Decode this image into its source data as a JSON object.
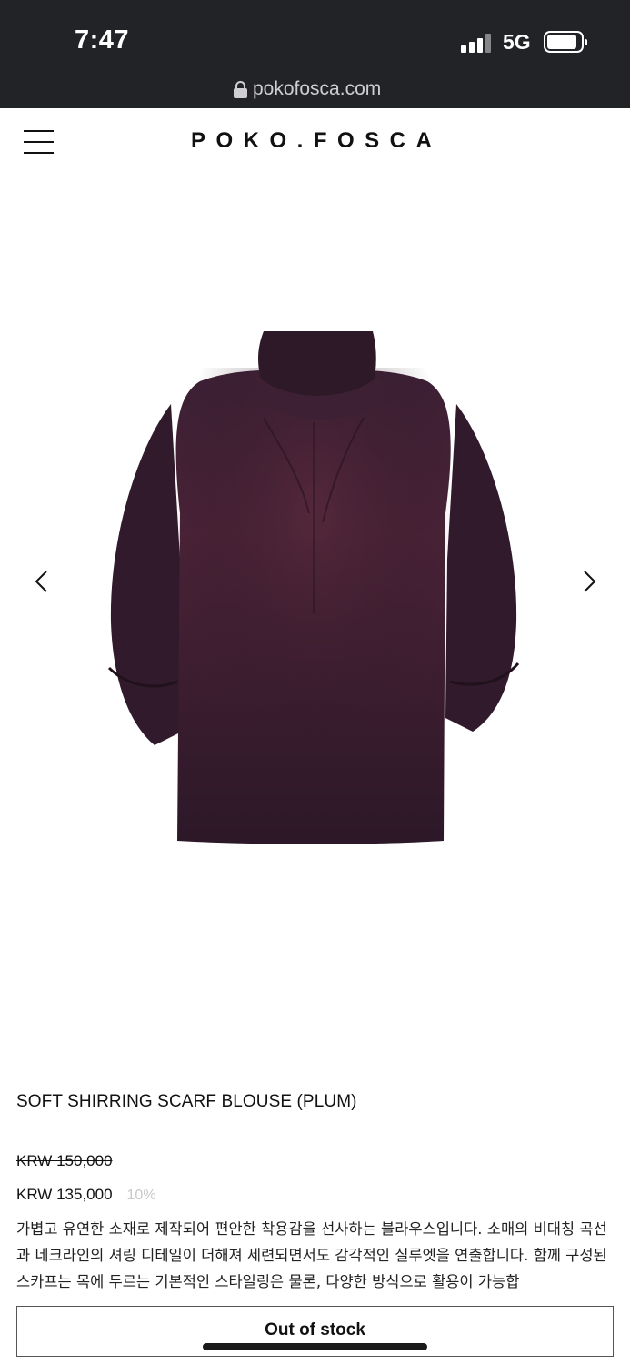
{
  "status_bar": {
    "time": "7:47",
    "network": "5G"
  },
  "browser": {
    "url": "pokofosca.com"
  },
  "header": {
    "logo": "POKO.FOSCA"
  },
  "product": {
    "title": "SOFT SHIRRING SCARF BLOUSE (PLUM)",
    "original_price": "KRW 150,000",
    "sale_price": "KRW 135,000",
    "discount": "10%",
    "description": "가볍고 유연한 소재로 제작되어 편안한 착용감을 선사하는 블라우스입니다. 소매의 비대칭 곡선과 네크라인의 셔링 디테일이 더해져 세련되면서도 감각적인 실루엣을 연출합니다. 함께 구성된 스카프는 목에 두르는 기본적인 스타일링은 물론, 다양한 방식으로 활용이 가능합",
    "image_color": "#3a1f33"
  },
  "actions": {
    "stock_button": "Out of stock"
  },
  "icons": {
    "menu": "hamburger-menu-icon",
    "prev": "chevron-left-icon",
    "next": "chevron-right-icon",
    "lock": "lock-icon"
  }
}
